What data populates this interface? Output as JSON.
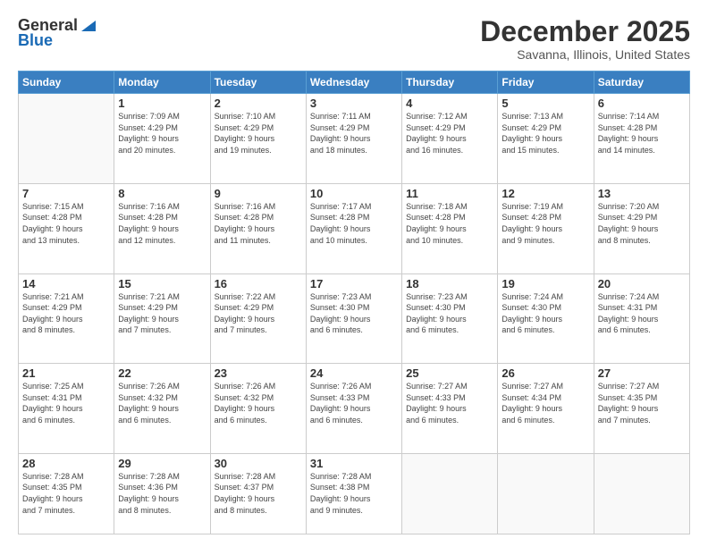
{
  "logo": {
    "line1": "General",
    "line2": "Blue"
  },
  "title": "December 2025",
  "location": "Savanna, Illinois, United States",
  "days_of_week": [
    "Sunday",
    "Monday",
    "Tuesday",
    "Wednesday",
    "Thursday",
    "Friday",
    "Saturday"
  ],
  "weeks": [
    [
      {
        "day": null,
        "sunrise": null,
        "sunset": null,
        "daylight": null
      },
      {
        "day": "1",
        "sunrise": "Sunrise: 7:09 AM",
        "sunset": "Sunset: 4:29 PM",
        "daylight": "Daylight: 9 hours and 20 minutes."
      },
      {
        "day": "2",
        "sunrise": "Sunrise: 7:10 AM",
        "sunset": "Sunset: 4:29 PM",
        "daylight": "Daylight: 9 hours and 19 minutes."
      },
      {
        "day": "3",
        "sunrise": "Sunrise: 7:11 AM",
        "sunset": "Sunset: 4:29 PM",
        "daylight": "Daylight: 9 hours and 18 minutes."
      },
      {
        "day": "4",
        "sunrise": "Sunrise: 7:12 AM",
        "sunset": "Sunset: 4:29 PM",
        "daylight": "Daylight: 9 hours and 16 minutes."
      },
      {
        "day": "5",
        "sunrise": "Sunrise: 7:13 AM",
        "sunset": "Sunset: 4:29 PM",
        "daylight": "Daylight: 9 hours and 15 minutes."
      },
      {
        "day": "6",
        "sunrise": "Sunrise: 7:14 AM",
        "sunset": "Sunset: 4:28 PM",
        "daylight": "Daylight: 9 hours and 14 minutes."
      }
    ],
    [
      {
        "day": "7",
        "sunrise": "Sunrise: 7:15 AM",
        "sunset": "Sunset: 4:28 PM",
        "daylight": "Daylight: 9 hours and 13 minutes."
      },
      {
        "day": "8",
        "sunrise": "Sunrise: 7:16 AM",
        "sunset": "Sunset: 4:28 PM",
        "daylight": "Daylight: 9 hours and 12 minutes."
      },
      {
        "day": "9",
        "sunrise": "Sunrise: 7:16 AM",
        "sunset": "Sunset: 4:28 PM",
        "daylight": "Daylight: 9 hours and 11 minutes."
      },
      {
        "day": "10",
        "sunrise": "Sunrise: 7:17 AM",
        "sunset": "Sunset: 4:28 PM",
        "daylight": "Daylight: 9 hours and 10 minutes."
      },
      {
        "day": "11",
        "sunrise": "Sunrise: 7:18 AM",
        "sunset": "Sunset: 4:28 PM",
        "daylight": "Daylight: 9 hours and 10 minutes."
      },
      {
        "day": "12",
        "sunrise": "Sunrise: 7:19 AM",
        "sunset": "Sunset: 4:28 PM",
        "daylight": "Daylight: 9 hours and 9 minutes."
      },
      {
        "day": "13",
        "sunrise": "Sunrise: 7:20 AM",
        "sunset": "Sunset: 4:29 PM",
        "daylight": "Daylight: 9 hours and 8 minutes."
      }
    ],
    [
      {
        "day": "14",
        "sunrise": "Sunrise: 7:21 AM",
        "sunset": "Sunset: 4:29 PM",
        "daylight": "Daylight: 9 hours and 8 minutes."
      },
      {
        "day": "15",
        "sunrise": "Sunrise: 7:21 AM",
        "sunset": "Sunset: 4:29 PM",
        "daylight": "Daylight: 9 hours and 7 minutes."
      },
      {
        "day": "16",
        "sunrise": "Sunrise: 7:22 AM",
        "sunset": "Sunset: 4:29 PM",
        "daylight": "Daylight: 9 hours and 7 minutes."
      },
      {
        "day": "17",
        "sunrise": "Sunrise: 7:23 AM",
        "sunset": "Sunset: 4:30 PM",
        "daylight": "Daylight: 9 hours and 6 minutes."
      },
      {
        "day": "18",
        "sunrise": "Sunrise: 7:23 AM",
        "sunset": "Sunset: 4:30 PM",
        "daylight": "Daylight: 9 hours and 6 minutes."
      },
      {
        "day": "19",
        "sunrise": "Sunrise: 7:24 AM",
        "sunset": "Sunset: 4:30 PM",
        "daylight": "Daylight: 9 hours and 6 minutes."
      },
      {
        "day": "20",
        "sunrise": "Sunrise: 7:24 AM",
        "sunset": "Sunset: 4:31 PM",
        "daylight": "Daylight: 9 hours and 6 minutes."
      }
    ],
    [
      {
        "day": "21",
        "sunrise": "Sunrise: 7:25 AM",
        "sunset": "Sunset: 4:31 PM",
        "daylight": "Daylight: 9 hours and 6 minutes."
      },
      {
        "day": "22",
        "sunrise": "Sunrise: 7:26 AM",
        "sunset": "Sunset: 4:32 PM",
        "daylight": "Daylight: 9 hours and 6 minutes."
      },
      {
        "day": "23",
        "sunrise": "Sunrise: 7:26 AM",
        "sunset": "Sunset: 4:32 PM",
        "daylight": "Daylight: 9 hours and 6 minutes."
      },
      {
        "day": "24",
        "sunrise": "Sunrise: 7:26 AM",
        "sunset": "Sunset: 4:33 PM",
        "daylight": "Daylight: 9 hours and 6 minutes."
      },
      {
        "day": "25",
        "sunrise": "Sunrise: 7:27 AM",
        "sunset": "Sunset: 4:33 PM",
        "daylight": "Daylight: 9 hours and 6 minutes."
      },
      {
        "day": "26",
        "sunrise": "Sunrise: 7:27 AM",
        "sunset": "Sunset: 4:34 PM",
        "daylight": "Daylight: 9 hours and 6 minutes."
      },
      {
        "day": "27",
        "sunrise": "Sunrise: 7:27 AM",
        "sunset": "Sunset: 4:35 PM",
        "daylight": "Daylight: 9 hours and 7 minutes."
      }
    ],
    [
      {
        "day": "28",
        "sunrise": "Sunrise: 7:28 AM",
        "sunset": "Sunset: 4:35 PM",
        "daylight": "Daylight: 9 hours and 7 minutes."
      },
      {
        "day": "29",
        "sunrise": "Sunrise: 7:28 AM",
        "sunset": "Sunset: 4:36 PM",
        "daylight": "Daylight: 9 hours and 8 minutes."
      },
      {
        "day": "30",
        "sunrise": "Sunrise: 7:28 AM",
        "sunset": "Sunset: 4:37 PM",
        "daylight": "Daylight: 9 hours and 8 minutes."
      },
      {
        "day": "31",
        "sunrise": "Sunrise: 7:28 AM",
        "sunset": "Sunset: 4:38 PM",
        "daylight": "Daylight: 9 hours and 9 minutes."
      },
      {
        "day": null,
        "sunrise": null,
        "sunset": null,
        "daylight": null
      },
      {
        "day": null,
        "sunrise": null,
        "sunset": null,
        "daylight": null
      },
      {
        "day": null,
        "sunrise": null,
        "sunset": null,
        "daylight": null
      }
    ]
  ]
}
